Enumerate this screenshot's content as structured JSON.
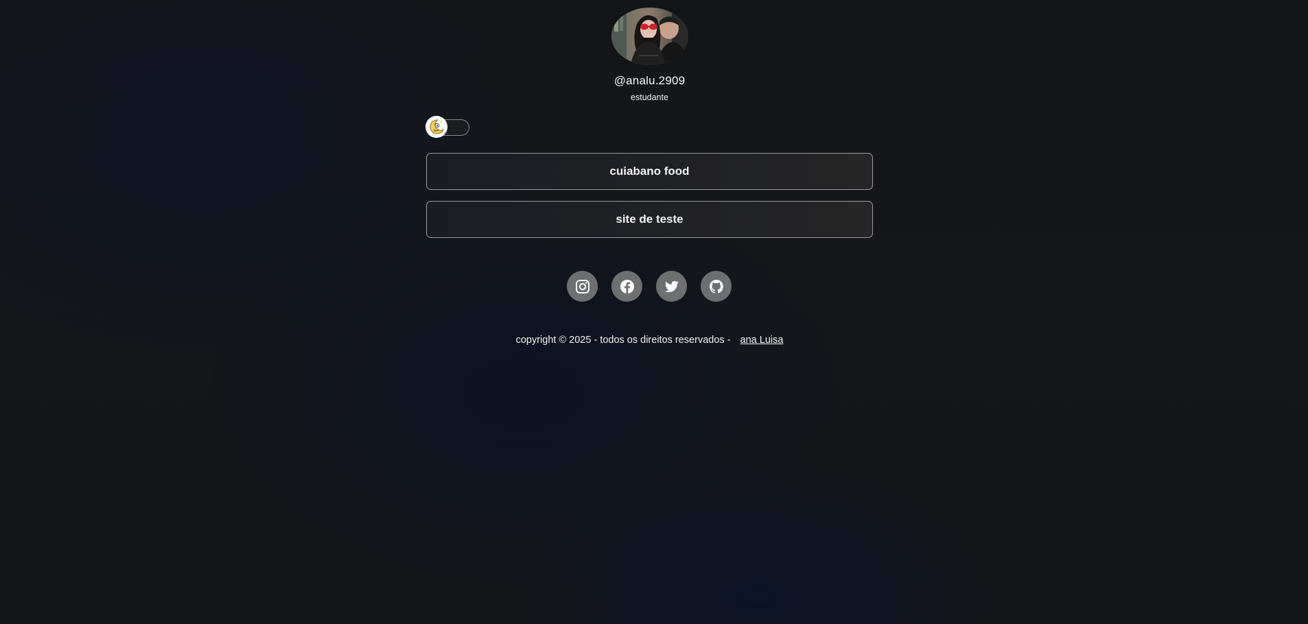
{
  "profile": {
    "username": "@analu.2909",
    "role": "estudante"
  },
  "theme_toggle": {
    "icon": "moon-icon",
    "state": "dark"
  },
  "links": [
    {
      "label": "cuiabano food"
    },
    {
      "label": "site de teste"
    }
  ],
  "socials": [
    {
      "icon": "instagram-icon"
    },
    {
      "icon": "facebook-icon"
    },
    {
      "icon": "twitter-icon"
    },
    {
      "icon": "github-icon"
    }
  ],
  "footer": {
    "text": "copyright © 2025 - todos os direitos reservados -",
    "author_link": "ana Luisa"
  },
  "colors": {
    "background": "#15171b",
    "button_border": "#9a9b9e",
    "social_circle": "#6e6f71",
    "text": "#f2f2f2"
  }
}
